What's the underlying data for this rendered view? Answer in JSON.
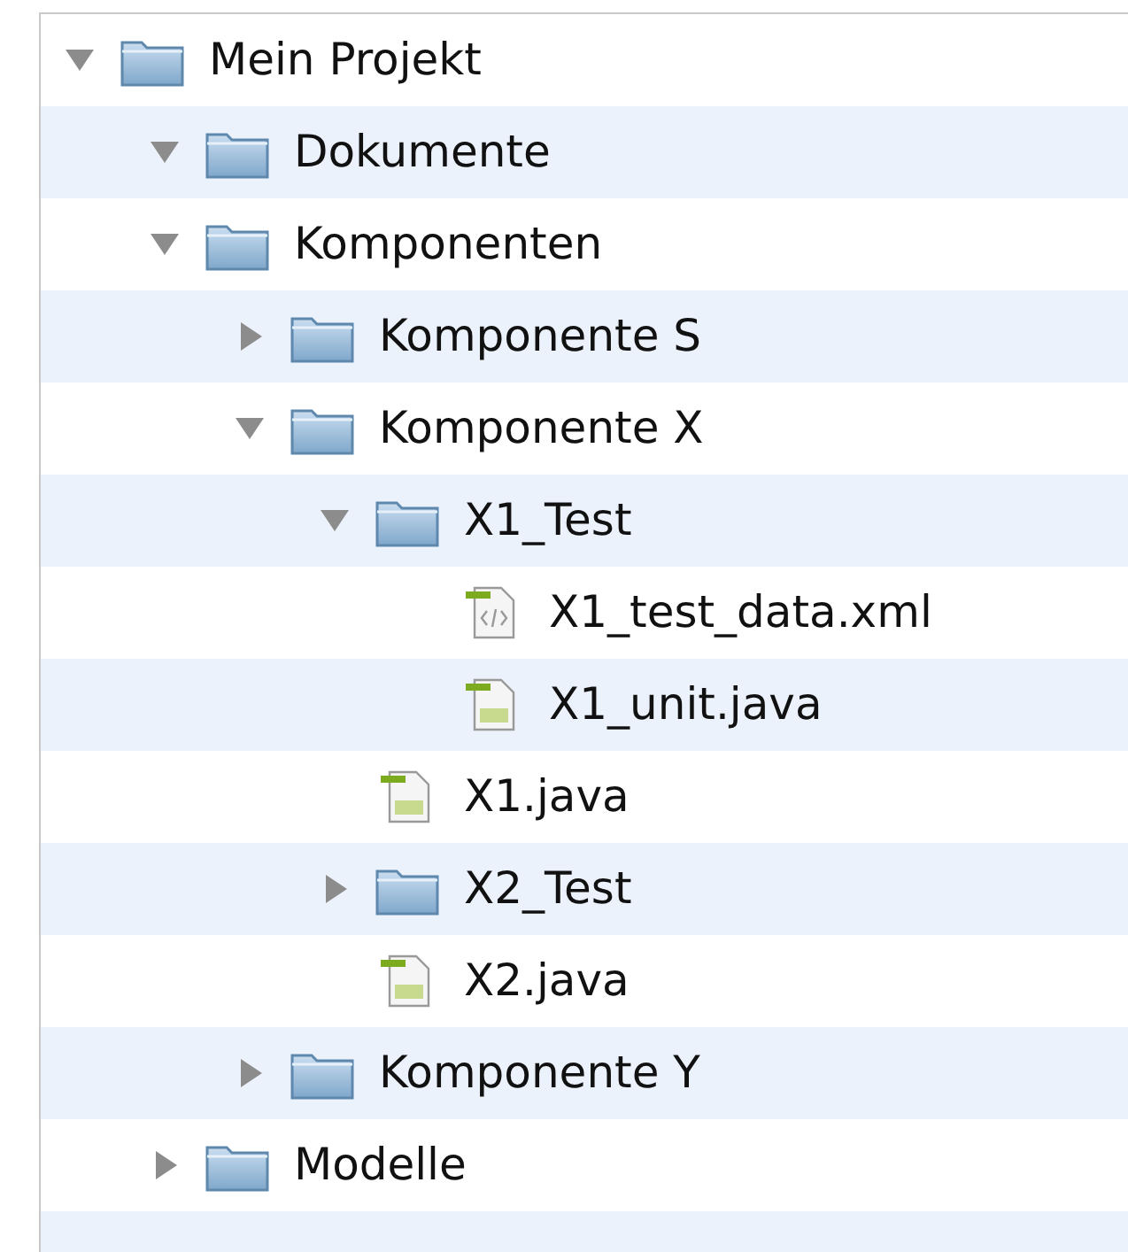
{
  "tree": [
    {
      "label": "Mein Projekt",
      "kind": "folder",
      "expanded": true,
      "children": [
        {
          "label": "Dokumente",
          "kind": "folder",
          "expanded": true
        },
        {
          "label": "Komponenten",
          "kind": "folder",
          "expanded": true,
          "children": [
            {
              "label": "Komponente S",
              "kind": "folder",
              "expanded": false
            },
            {
              "label": "Komponente X",
              "kind": "folder",
              "expanded": true,
              "children": [
                {
                  "label": "X1_Test",
                  "kind": "folder",
                  "expanded": true,
                  "children": [
                    {
                      "label": "X1_test_data.xml",
                      "kind": "xml"
                    },
                    {
                      "label": "X1_unit.java",
                      "kind": "java"
                    }
                  ]
                },
                {
                  "label": "X1.java",
                  "kind": "java"
                },
                {
                  "label": "X2_Test",
                  "kind": "folder",
                  "expanded": false
                },
                {
                  "label": "X2.java",
                  "kind": "java"
                }
              ]
            },
            {
              "label": "Komponente Y",
              "kind": "folder",
              "expanded": false
            }
          ]
        },
        {
          "label": "Modelle",
          "kind": "folder",
          "expanded": false
        }
      ]
    }
  ]
}
